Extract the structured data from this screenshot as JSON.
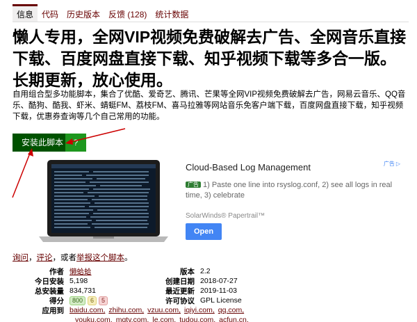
{
  "tabs": [
    "信息",
    "代码",
    "历史版本",
    "反馈 (128)",
    "统计数据"
  ],
  "title": "懒人专用，全网VIP视频免费破解去广告、全网音乐直接下载、百度网盘直接下载、知乎视频下载等多合一版。长期更新，放心使用。",
  "description": "自用组合型多功能脚本，集合了优酷、爱奇艺、腾讯、芒果等全网VIP视频免费破解去广告，网易云音乐、QQ音乐、酷狗、酷我、虾米、蜻蜓FM、荔枝FM、喜马拉雅等网站音乐免客户端下载，百度网盘直接下载，知乎视频下载，优惠券查询等几个自己常用的功能。",
  "install": {
    "label": "安装此脚本",
    "help": "?"
  },
  "ad": {
    "headline": "Cloud-Based Log Management",
    "badge": "广告",
    "tag": "广告",
    "body": "1) Paste one line into rsyslog.conf, 2) see all logs in real time, 3) celebrate",
    "brand": "SolarWinds® Papertrail™",
    "cta": "Open"
  },
  "feedback": {
    "ask": "询问",
    "sep1": "，",
    "review": "评论",
    "sep2": "，或者",
    "report": "举报这个脚本",
    "end": "。"
  },
  "info": {
    "author_label": "作者",
    "author": "懒蛤蛤",
    "daily_label": "今日安装",
    "daily": "5,198",
    "total_label": "总安装量",
    "total": "834,731",
    "score_label": "得分",
    "score_good": "800",
    "score_ok": "6",
    "score_bad": "5",
    "applies_label": "应用到",
    "version_label": "版本",
    "version": "2.2",
    "created_label": "创建日期",
    "created": "2018-07-27",
    "updated_label": "最近更新",
    "updated": "2019-11-03",
    "license_label": "许可协议",
    "license": "GPL License",
    "sites_row1": [
      "baidu.com,",
      "zhihu.com,",
      "vzuu.com,",
      "iqiyi.com,",
      "qq.com,"
    ],
    "sites_row2": [
      "youku.com,",
      "mgtv.com,",
      "le.com,",
      "tudou.com,",
      "acfun.cn,"
    ]
  },
  "colors": {
    "accent": "#670000",
    "install": "#005200",
    "help": "#1e971e",
    "arrow": "#cc0000",
    "ad_blue": "#4285f4"
  }
}
